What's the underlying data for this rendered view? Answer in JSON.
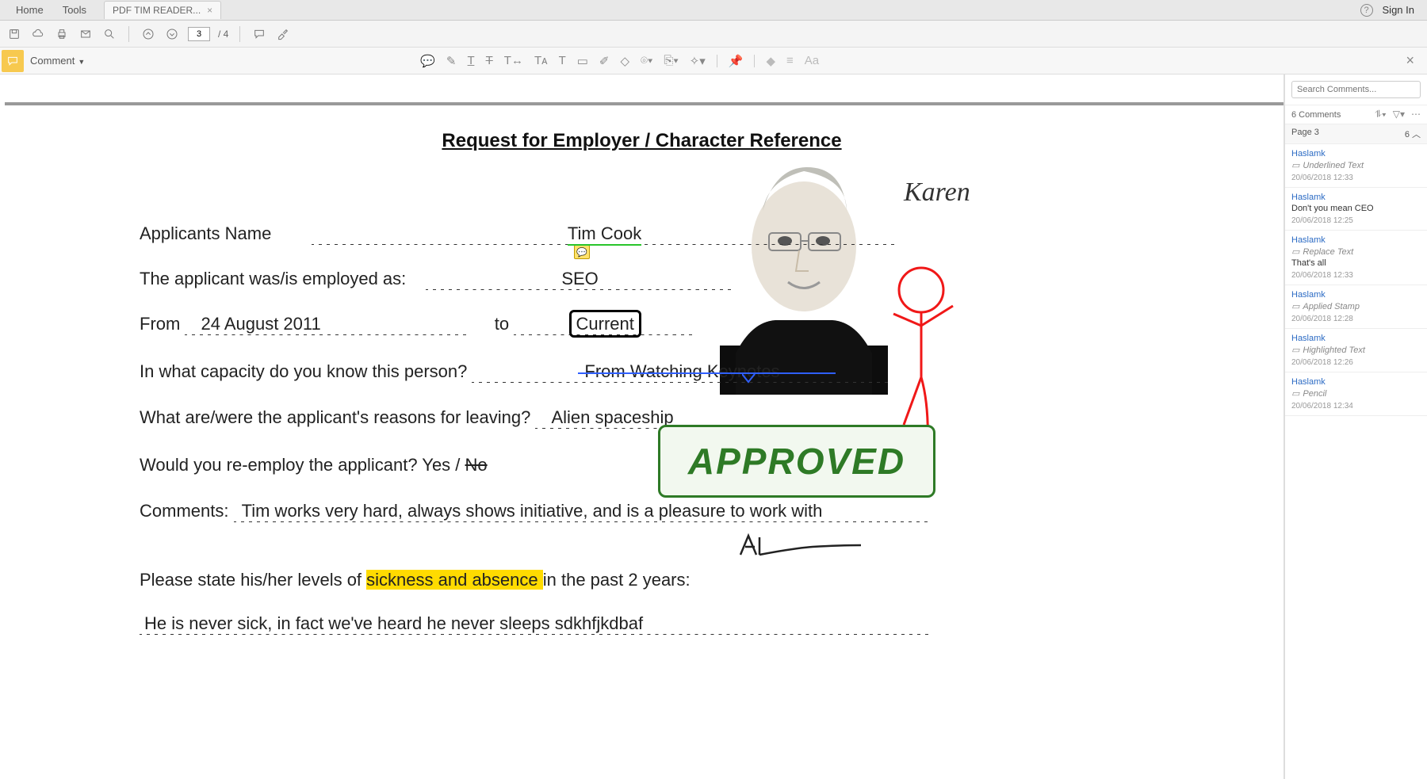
{
  "app": {
    "home_label": "Home",
    "tools_label": "Tools",
    "tab_title": "PDF TIM READER...",
    "sign_in": "Sign In"
  },
  "toolbar": {
    "page_current": "3",
    "page_total": "/ 4"
  },
  "commentbar": {
    "label": "Comment"
  },
  "document": {
    "title": "Request for Employer / Character Reference",
    "signature_name": "Karen",
    "applicant_name_label": "Applicants Name",
    "applicant_name_value": "Tim Cook",
    "employed_as_label": "The applicant was/is employed as:",
    "employed_as_value": "SEO",
    "from_label": "From",
    "from_value": "24 August 2011",
    "to_label": "to",
    "to_value": "Current",
    "capacity_label": "In what capacity do you know this person?",
    "capacity_value": "From Watching Keynotes",
    "leaving_label": "What are/were the applicant's reasons for leaving?",
    "leaving_value": "Alien spaceship",
    "reemploy_label": "Would you re-employ the applicant?   Yes / ",
    "reemploy_no": "No",
    "comments_label": "Comments:",
    "comments_value": "Tim works very hard, always shows initiative, and is a pleasure to work with",
    "sickness_label_pre": "Please state his/her levels of ",
    "sickness_highlight": "sickness and absence ",
    "sickness_label_post": "in the past 2 years:",
    "sickness_value": "He is never sick, in fact we've heard he never sleeps sdkhfjkdbaf",
    "stamp": "APPROVED"
  },
  "comments_panel": {
    "search_placeholder": "Search Comments...",
    "count_label": "6 Comments",
    "page_label": "Page 3",
    "page_count": "6",
    "items": [
      {
        "author": "Haslamk",
        "type": "Underlined Text",
        "body": "",
        "ts": "20/06/2018  12:33"
      },
      {
        "author": "Haslamk",
        "type": "",
        "body": "Don't you mean CEO",
        "ts": "20/06/2018  12:25"
      },
      {
        "author": "Haslamk",
        "type": "Replace Text",
        "body": "That's all",
        "ts": "20/06/2018  12:33"
      },
      {
        "author": "Haslamk",
        "type": "Applied Stamp",
        "body": "",
        "ts": "20/06/2018  12:28"
      },
      {
        "author": "Haslamk",
        "type": "Highlighted Text",
        "body": "",
        "ts": "20/06/2018  12:26"
      },
      {
        "author": "Haslamk",
        "type": "Pencil",
        "body": "",
        "ts": "20/06/2018  12:34"
      }
    ]
  }
}
